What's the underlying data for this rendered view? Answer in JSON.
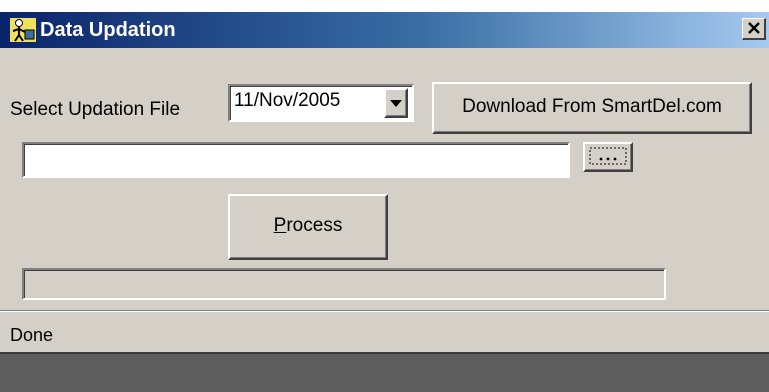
{
  "window": {
    "title": "Data Updation",
    "close_icon": "close-icon",
    "app_icon": "person-icon"
  },
  "form": {
    "select_file_label": "Select Updation File",
    "date_value": "11/Nov/2005",
    "download_button": "Download From SmartDel.com",
    "file_path_value": "",
    "browse_icon": "ellipsis-icon",
    "process_button_prefix": "P",
    "process_button_rest": "rocess",
    "progress": 0
  },
  "status": {
    "text": "Done"
  }
}
